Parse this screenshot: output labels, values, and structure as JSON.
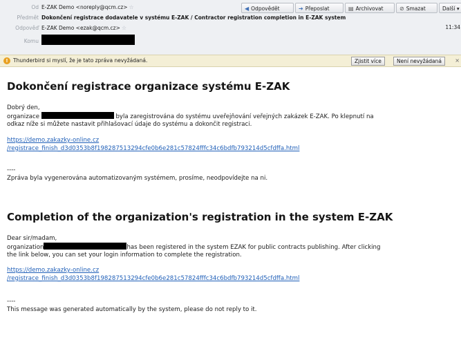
{
  "header": {
    "from": {
      "label": "Od",
      "value": "E-ZAK Demo <noreply@qcm.cz>"
    },
    "subject": {
      "label": "Předmět",
      "value": "Dokončení registrace dodavatele v systému E-ZAK / Contractor registration completion in E-ZAK system"
    },
    "reply_to": {
      "label": "Odpověď",
      "value": "E-ZAK Demo <ezak@qcm.cz>"
    },
    "to": {
      "label": "Komu"
    },
    "time": "11:34",
    "buttons": {
      "reply": "Odpovědět",
      "forward": "Přeposlat",
      "archive": "Archivovat",
      "delete": "Smazat",
      "more": "Další"
    }
  },
  "junk_bar": {
    "message": "Thunderbird si myslí, že je tato zpráva nevyžádaná.",
    "learn_more": "Zjistit více",
    "not_junk": "Není nevyžádaná",
    "close": "×"
  },
  "body_cz": {
    "title": "Dokončení registrace organizace systému E-ZAK",
    "greeting": "Dobrý den,",
    "org_word": "organizace",
    "line1_rest": "byla zaregistrována do systému uveřejňování veřejných zakázek E-ZAK. Po klepnutí na",
    "line2": "odkaz níže si můžete nastavit přihlašovací údaje do systému a dokončit registraci.",
    "link_line1": "https://demo.zakazky-online.cz",
    "link_line2": "/registrace_finish_d3d0353b8f198287513294cfe0b6e281c57824fffc34c6bdfb793214d5cfdffa.html",
    "sep": "----",
    "footer": "Zpráva byla vygenerována automatizovaným systémem, prosíme, neodpovídejte na ni."
  },
  "body_en": {
    "title": "Completion of the organization's registration in the system E-ZAK",
    "greeting": "Dear sir/madam,",
    "org_word": "organization",
    "line1_rest": "has been registered in the system EZAK for public contracts publishing. After clicking",
    "line2": "the link below, you can set your login information to complete the registration.",
    "link_line1": "https://demo.zakazky-online.cz",
    "link_line2": "/registrace_finish_d3d0353b8f198287513294cfe0b6e281c57824fffc34c6bdfb793214d5cfdffa.html",
    "sep": "----",
    "footer": "This message was generated automatically by the system, please do not reply to it."
  }
}
